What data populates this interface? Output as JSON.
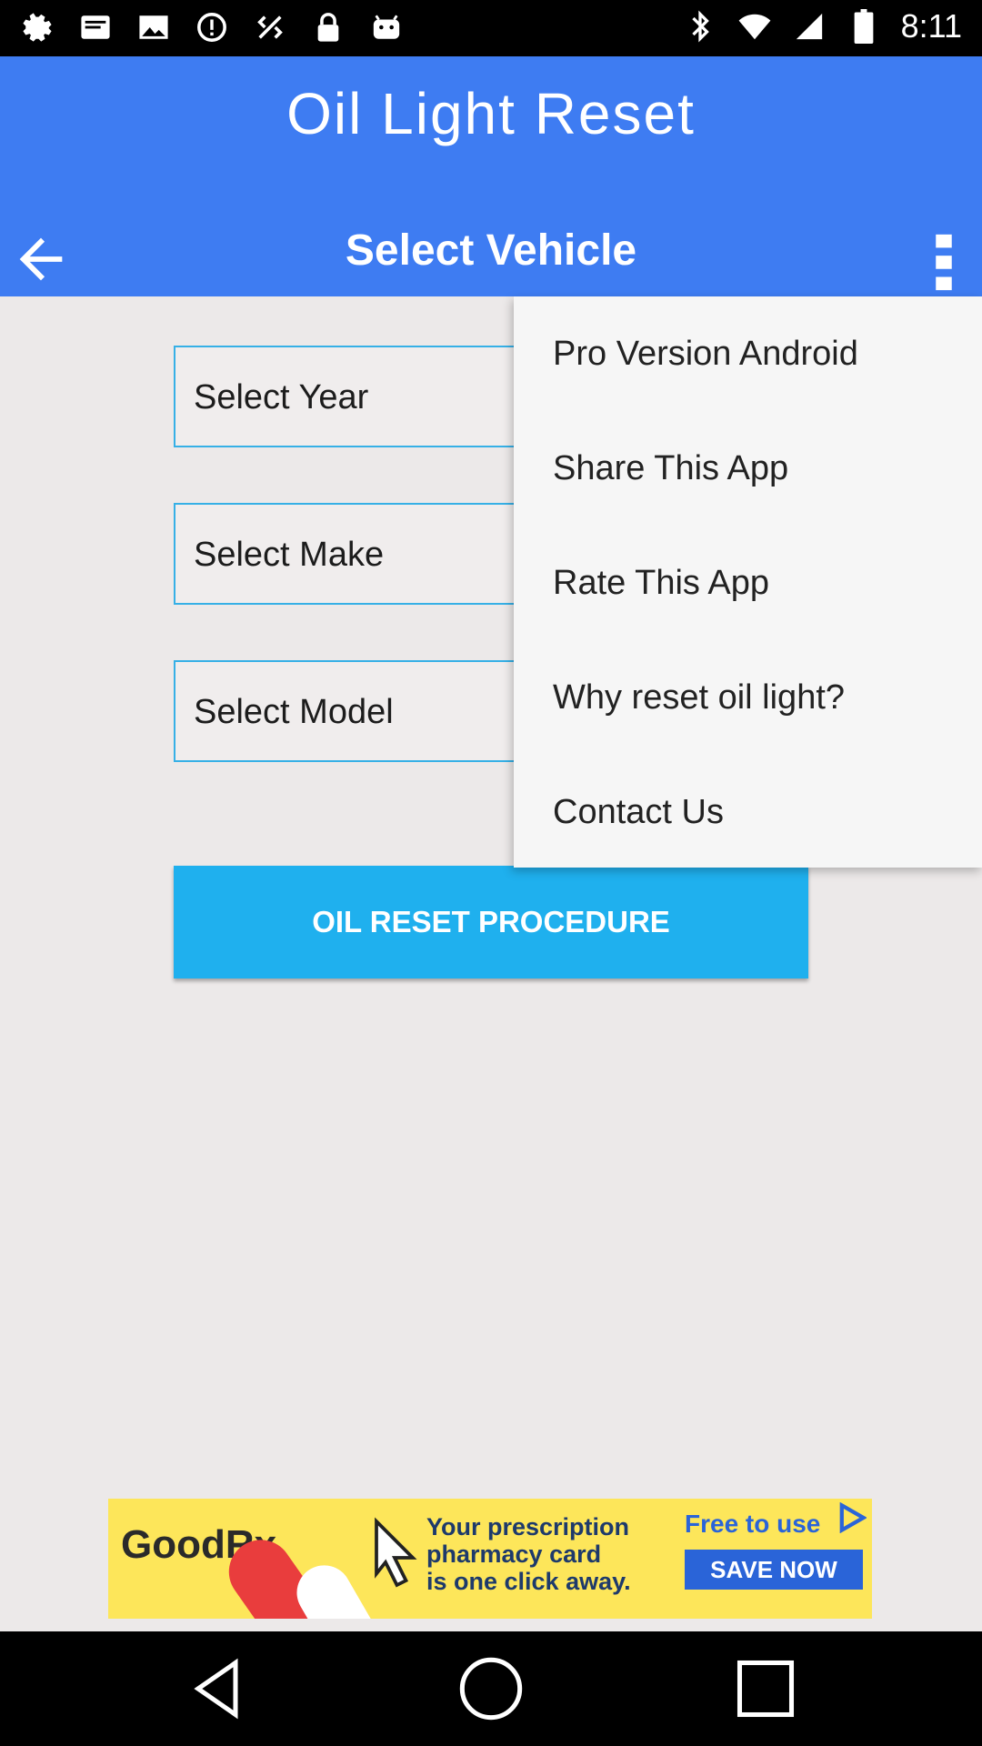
{
  "status_bar": {
    "time": "8:11",
    "left_icons": [
      "settings-icon",
      "message-icon",
      "image-icon",
      "alert-icon",
      "location-icon",
      "lock-icon",
      "android-icon"
    ],
    "right_icons": [
      "bluetooth-icon",
      "wifi-icon",
      "signal-icon",
      "battery-icon"
    ]
  },
  "app": {
    "logo_title": "Oil Light Reset",
    "toolbar_title": "Select Vehicle",
    "back_icon": "arrow-back-icon",
    "overflow_icon": "more-vert-icon",
    "colors": {
      "header": "#3e7cf2",
      "button": "#1fb0ee",
      "field_border": "#36b0e6"
    }
  },
  "form": {
    "year_label": "Select Year",
    "make_label": "Select Make",
    "model_label": "Select Model",
    "submit_label": "OIL RESET PROCEDURE"
  },
  "menu": {
    "items": [
      {
        "label": "Pro Version Android"
      },
      {
        "label": "Share This App"
      },
      {
        "label": "Rate This App"
      },
      {
        "label": "Why reset oil light?"
      },
      {
        "label": "Contact Us"
      }
    ]
  },
  "ad": {
    "brand": "GoodRx",
    "line1": "Your prescription",
    "line2": "pharmacy card",
    "line3": "is one click away.",
    "free_text": "Free to use",
    "cta": "SAVE NOW"
  },
  "navbar": {
    "back": "nav-back-icon",
    "home": "nav-home-icon",
    "recents": "nav-recents-icon"
  }
}
